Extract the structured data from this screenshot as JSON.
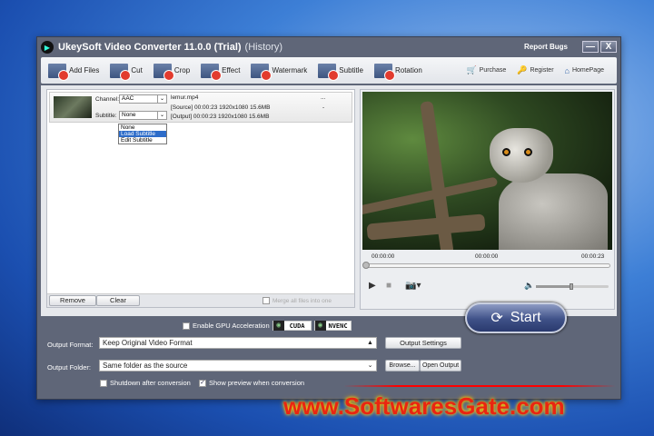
{
  "window": {
    "title": "UkeySoft Video Converter 11.0.0 (Trial)",
    "history": "(History)",
    "report_bugs": "Report Bugs",
    "minimize": "—",
    "close": "X"
  },
  "toolbar": {
    "items": [
      "Add Files",
      "Cut",
      "Crop",
      "Effect",
      "Watermark",
      "Subtitle",
      "Rotation"
    ],
    "links": [
      "Purchase",
      "Register",
      "HomePage"
    ]
  },
  "file": {
    "channel_label": "Channel:",
    "channel_value": "AAC",
    "subtitle_label": "Subtitle:",
    "subtitle_value": "None",
    "name": "lemur.mp4",
    "more": "...",
    "dash": "-",
    "source": "[Source]  00:00:23  1920x1080  15.6MB",
    "output": "[Output]  00:00:23  1920x1080  15.6MB",
    "subtitle_options": [
      "None",
      "Load Subtitle",
      "Edit Subtitle"
    ],
    "subtitle_highlighted": "Load Subtitle"
  },
  "list": {
    "remove": "Remove",
    "clear": "Clear",
    "merge": "Merge all files into one"
  },
  "player": {
    "time_left": "00:00:00",
    "time_mid": "00:00:00",
    "time_right": "00:00:23",
    "progress": 0,
    "volume": 0.48
  },
  "bottom": {
    "gpu_label": "Enable GPU Acceleration",
    "cuda": "CUDA",
    "nvenc": "NVENC",
    "format_label": "Output Format:",
    "format_value": "Keep Original Video Format",
    "output_settings": "Output Settings",
    "folder_label": "Output Folder:",
    "folder_value": "Same folder as the source",
    "browse": "Browse...",
    "open_output": "Open Output",
    "shutdown": "Shutdown after conversion",
    "show_preview": "Show preview when conversion",
    "start": "Start"
  },
  "watermark": "www.SoftwaresGate.com"
}
